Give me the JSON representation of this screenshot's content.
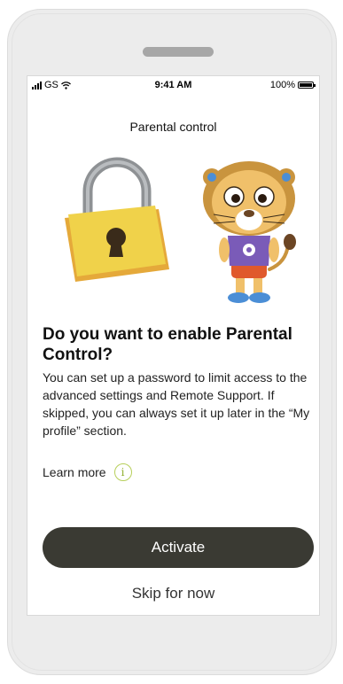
{
  "status_bar": {
    "carrier": "GS",
    "time": "9:41 AM",
    "battery": "100%"
  },
  "header": {
    "title": "Parental control"
  },
  "content": {
    "heading": "Do you want to enable Parental Control?",
    "body": "You can set up a password to limit access to the advanced settings and Remote Support. If skipped, you can always set it up later in the “My profile” section.",
    "learn_more_label": "Learn more",
    "info_icon_glyph": "i"
  },
  "actions": {
    "activate_label": "Activate",
    "skip_label": "Skip for now"
  },
  "colors": {
    "primary_button": "#3a3a33",
    "info_accent": "#b7cf5a",
    "lock_body": "#f0d24a",
    "lion_shirt": "#7a5bb8"
  },
  "icons": [
    "signal-icon",
    "wifi-icon",
    "battery-icon",
    "padlock-illustration",
    "lion-mascot-illustration",
    "info-icon"
  ]
}
